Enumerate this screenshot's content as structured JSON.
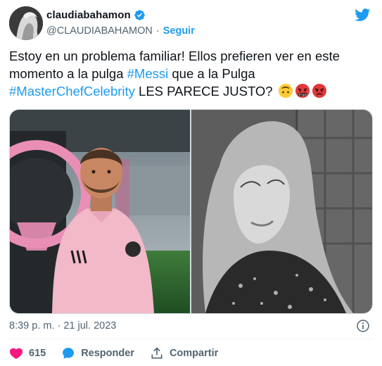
{
  "author": {
    "display_name": "claudiabahamon",
    "handle": "@CLAUDIABAHAMON",
    "separator": "·",
    "follow_label": "Seguir"
  },
  "tweet": {
    "text_part1": "Estoy en un problema familiar! Ellos prefieren ver en este momento a la pulga ",
    "hashtag1": "#Messi",
    "text_part2": " que a la Pulga ",
    "hashtag2": "#MasterChefCelebrity",
    "text_part3": "   LES PARECE JUSTO? "
  },
  "emojis": [
    "upside-down-face-emoji",
    "face-with-symbols-emoji",
    "angry-face-emoji"
  ],
  "timestamp": "8:39 p. m. · 21 jul. 2023",
  "actions": {
    "like_count": "615",
    "reply_label": "Responder",
    "share_label": "Compartir"
  },
  "colors": {
    "accent": "#1d9bf0",
    "like": "#f91880",
    "muted": "#536471",
    "text": "#0f1419"
  },
  "icons": [
    "verified-badge-icon",
    "twitter-bird-icon",
    "info-icon",
    "heart-icon",
    "reply-icon",
    "share-icon"
  ]
}
